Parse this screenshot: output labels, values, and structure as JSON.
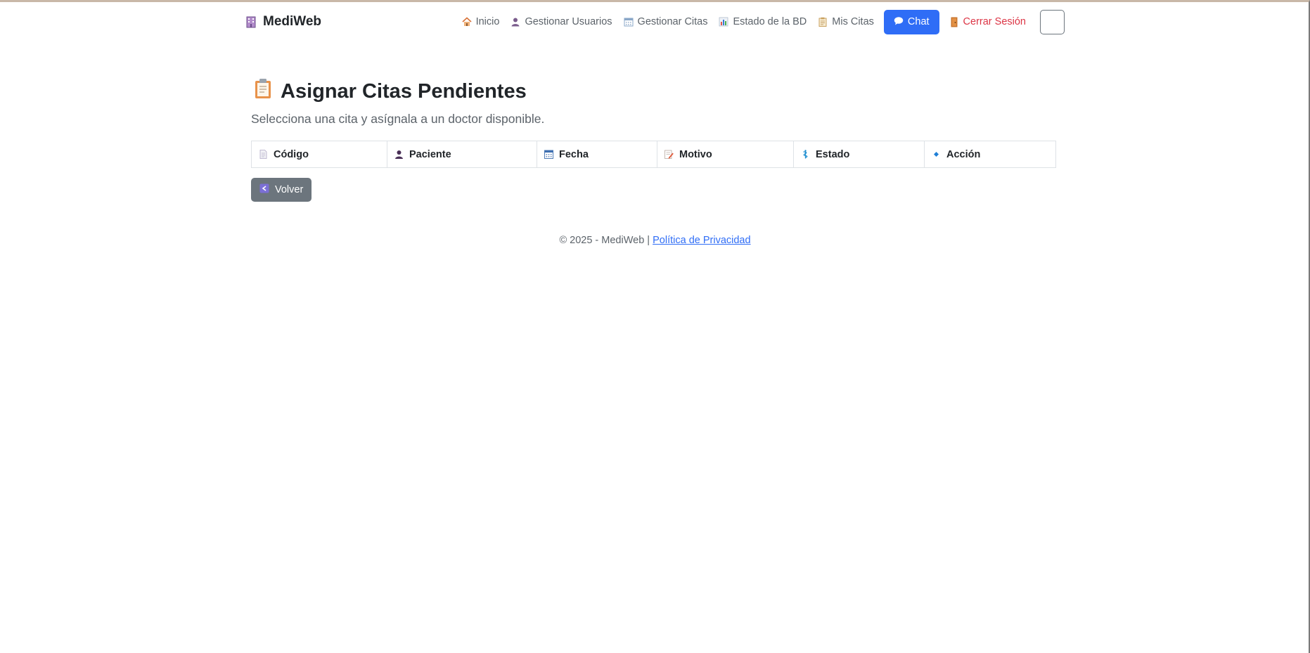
{
  "brand": {
    "name": "MediWeb",
    "icon": "hospital-icon"
  },
  "nav": {
    "items": [
      {
        "label": "Inicio",
        "icon": "house-icon"
      },
      {
        "label": "Gestionar Usuarios",
        "icon": "user-icon"
      },
      {
        "label": "Gestionar Citas",
        "icon": "calendar-icon"
      },
      {
        "label": "Estado de la BD",
        "icon": "bar-chart-icon"
      },
      {
        "label": "Mis Citas",
        "icon": "clipboard-icon"
      }
    ],
    "chat_label": "Chat",
    "logout_label": "Cerrar Sesión",
    "theme_icon": "moon-icon"
  },
  "page": {
    "title": "Asignar Citas Pendientes",
    "title_icon": "clipboard-icon",
    "subtitle": "Selecciona una cita y asígnala a un doctor disponible."
  },
  "table": {
    "columns": [
      {
        "label": "Código",
        "icon": "document-icon"
      },
      {
        "label": "Paciente",
        "icon": "user-icon"
      },
      {
        "label": "Fecha",
        "icon": "calendar-icon"
      },
      {
        "label": "Motivo",
        "icon": "memo-icon"
      },
      {
        "label": "Estado",
        "icon": "medical-icon"
      },
      {
        "label": "Acción",
        "icon": "diamond-icon"
      }
    ],
    "rows": []
  },
  "back_button": {
    "label": "Volver",
    "icon": "back-arrow-icon"
  },
  "footer": {
    "copyright": "© 2025 - MediWeb |",
    "privacy_link": "Política de Privacidad"
  },
  "colors": {
    "primary": "#2f6df6",
    "danger": "#dc3545",
    "secondary": "#6c757d",
    "text": "#212529",
    "muted": "#5c636a"
  }
}
